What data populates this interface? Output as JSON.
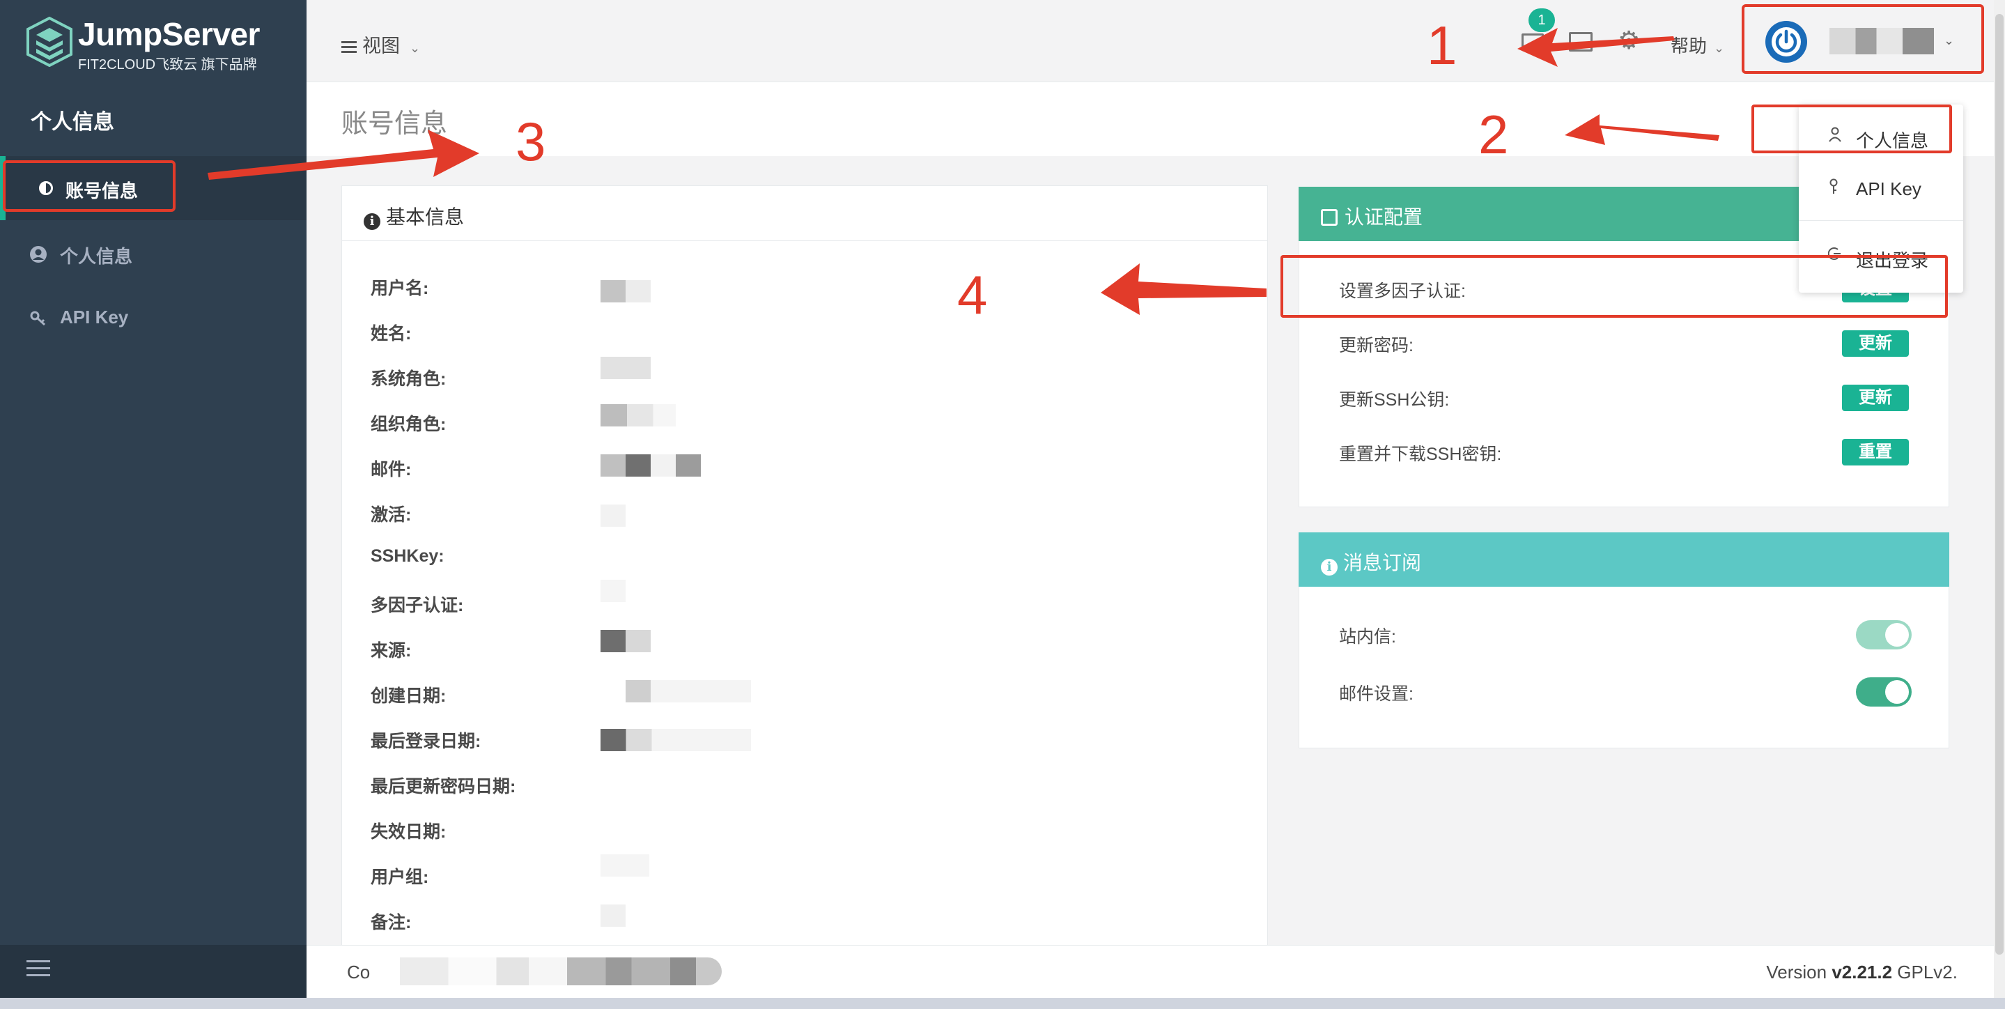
{
  "sidebar": {
    "logo_title": "JumpServer",
    "logo_subtitle": "FIT2CLOUD飞致云 旗下品牌",
    "heading": "个人信息",
    "items": [
      {
        "label": "账号信息",
        "icon": "half-circle-icon",
        "active": true
      },
      {
        "label": "个人信息",
        "icon": "user-circle-icon",
        "active": false
      },
      {
        "label": "API Key",
        "icon": "key-icon",
        "active": false
      }
    ]
  },
  "topbar": {
    "view_label": "视图",
    "message_count": "1",
    "help_label": "帮助"
  },
  "dropdown": {
    "items": [
      {
        "label": "个人信息",
        "icon": "user-icon"
      },
      {
        "label": "API Key",
        "icon": "key-icon"
      },
      {
        "label": "退出登录",
        "icon": "logout-icon"
      }
    ]
  },
  "page": {
    "title": "账号信息"
  },
  "basic_info": {
    "title": "基本信息",
    "fields": [
      {
        "label": "用户名:"
      },
      {
        "label": "姓名:"
      },
      {
        "label": "系统角色:"
      },
      {
        "label": "组织角色:"
      },
      {
        "label": "邮件:"
      },
      {
        "label": "激活:"
      },
      {
        "label": "SSHKey:"
      },
      {
        "label": "多因子认证:"
      },
      {
        "label": "来源:"
      },
      {
        "label": "创建日期:"
      },
      {
        "label": "最后登录日期:"
      },
      {
        "label": "最后更新密码日期:"
      },
      {
        "label": "失效日期:"
      },
      {
        "label": "用户组:"
      },
      {
        "label": "备注:"
      }
    ]
  },
  "auth_config": {
    "title": "认证配置",
    "rows": [
      {
        "label": "设置多因子认证:",
        "button": "设置"
      },
      {
        "label": "更新密码:",
        "button": "更新"
      },
      {
        "label": "更新SSH公钥:",
        "button": "更新"
      },
      {
        "label": "重置并下载SSH密钥:",
        "button": "重置"
      }
    ]
  },
  "subscription": {
    "title": "消息订阅",
    "rows": [
      {
        "label": "站内信:",
        "enabled": true,
        "disabled_control": true
      },
      {
        "label": "邮件设置:",
        "enabled": true,
        "disabled_control": false
      }
    ]
  },
  "footer": {
    "left_prefix": "Co",
    "version_prefix": "Version ",
    "version_number": "v2.21.2",
    "version_suffix": " GPLv2."
  },
  "annotations": [
    "1",
    "2",
    "3",
    "4"
  ],
  "colors": {
    "sidebar": "#2f4050",
    "primary": "#1ab394",
    "auth_header": "#46b393",
    "subscribe_header": "#5cc8c5",
    "annotation_red": "#e23b2a"
  }
}
